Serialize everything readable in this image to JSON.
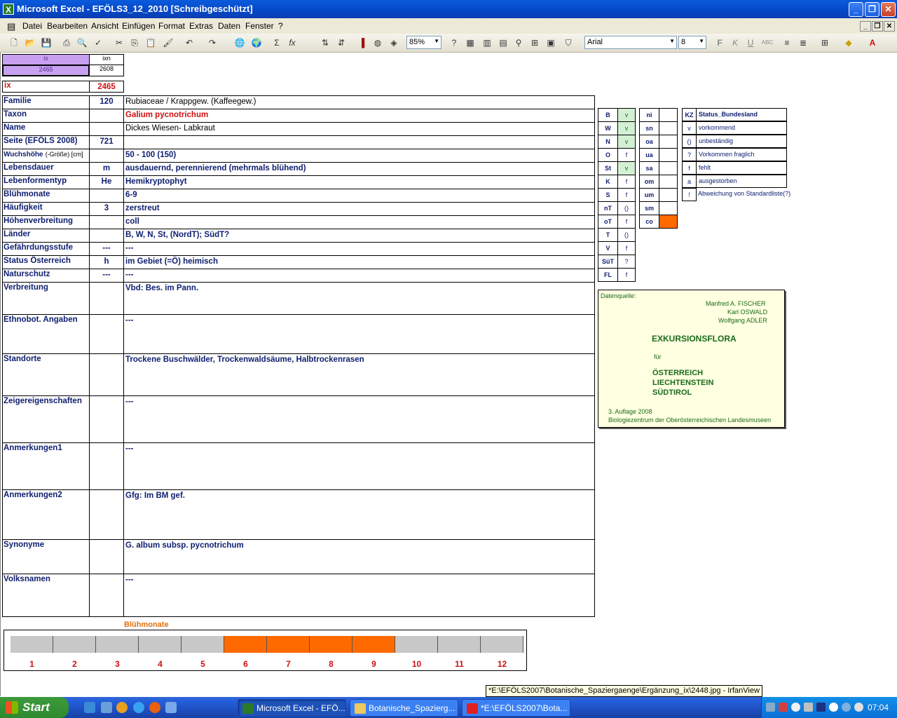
{
  "window": {
    "title": "Microsoft Excel - EFÖLS3_12_2010  [Schreibgeschützt]"
  },
  "menu": [
    "Datei",
    "Bearbeiten",
    "Ansicht",
    "Einfügen",
    "Format",
    "Extras",
    "Daten",
    "Fenster",
    "?"
  ],
  "toolbar": {
    "zoom": "85%",
    "font": "Arial",
    "font_size": "8"
  },
  "index": {
    "ix_label": "ix",
    "ixn_label": "ixn",
    "ix_value": "2465",
    "ixn_value": "2608",
    "ix_row_label": "ix",
    "ix_row_value": "2465"
  },
  "fields": [
    {
      "label": "Familie",
      "mid": "120",
      "value": "Rubiaceae  /  Krappgew. (Kaffeegew.)"
    },
    {
      "label": "Taxon",
      "mid": "",
      "value": "Galium pycnotrichum"
    },
    {
      "label": "Name",
      "mid": "",
      "value": "Dickes Wiesen- Labkraut"
    },
    {
      "label": "Seite (EFÖLS 2008)",
      "mid": "721",
      "value": ""
    },
    {
      "label": "Wuchshöhe",
      "label_suffix": "(-Größe) [cm]",
      "mid": "",
      "value": "50 - 100 (150)"
    },
    {
      "label": "Lebensdauer",
      "mid": "m",
      "value": "ausdauernd, perennierend (mehrmals blühend)"
    },
    {
      "label": "Lebenformentyp",
      "mid": "He",
      "value": "Hemikryptophyt"
    },
    {
      "label": "Blühmonate",
      "mid": "",
      "value": "6-9"
    },
    {
      "label": "Häufigkeit",
      "mid": "3",
      "value": "zerstreut"
    },
    {
      "label": "Höhenverbreitung",
      "mid": "",
      "value": "coll"
    },
    {
      "label": "Länder",
      "mid": "",
      "value": "B, W, N, St, (NordT); SüdT?"
    },
    {
      "label": "Gefährdungsstufe",
      "mid": "---",
      "value": "---"
    },
    {
      "label": "Status Österreich",
      "mid": "h",
      "value": "im Gebiet (=Ö) heimisch"
    },
    {
      "label": "Naturschutz",
      "mid": "---",
      "value": "---"
    },
    {
      "label": "Verbreitung",
      "mid": "",
      "value": "Vbd: Bes. im Pann."
    },
    {
      "label": "Ethnobot. Angaben",
      "mid": "",
      "value": "---"
    },
    {
      "label": "Standorte",
      "mid": "",
      "value": "Trockene Buschwälder, Trockenwaldsäume, Halbtrockenrasen"
    },
    {
      "label": "Zeigereigenschaften",
      "mid": "",
      "value": "---"
    },
    {
      "label": "Anmerkungen1",
      "mid": "",
      "value": "---"
    },
    {
      "label": "Anmerkungen2",
      "mid": "",
      "value": "Gfg: Im BM gef."
    },
    {
      "label": "Synonyme",
      "mid": "",
      "value": "G. album subsp. pycnotrichum"
    },
    {
      "label": "Volksnamen",
      "mid": "",
      "value": "---"
    }
  ],
  "states": [
    {
      "code": "B",
      "status": "v"
    },
    {
      "code": "W",
      "status": "v"
    },
    {
      "code": "N",
      "status": "v"
    },
    {
      "code": "O",
      "status": "f"
    },
    {
      "code": "St",
      "status": "v"
    },
    {
      "code": "K",
      "status": "f"
    },
    {
      "code": "S",
      "status": "f"
    },
    {
      "code": "nT",
      "status": "()"
    },
    {
      "code": "oT",
      "status": "f"
    },
    {
      "code": "T",
      "status": "()"
    },
    {
      "code": "V",
      "status": "f"
    },
    {
      "code": "SüT",
      "status": "?"
    },
    {
      "code": "FL",
      "status": "f"
    }
  ],
  "altitude": [
    "ni",
    "sn",
    "oa",
    "ua",
    "sa",
    "om",
    "um",
    "sm",
    "co"
  ],
  "altitude_highlight_color": "#ff6a00",
  "legend": {
    "header_kz": "KZ",
    "header_status": "Status_Bundesland",
    "items": [
      {
        "kz": "v",
        "text": "vorkommend"
      },
      {
        "kz": "()",
        "text": "unbeständig"
      },
      {
        "kz": "?",
        "text": "Vorkommen fraglich"
      },
      {
        "kz": "f",
        "text": "fehlt"
      },
      {
        "kz": "a",
        "text": "ausgestorben"
      },
      {
        "kz": "!",
        "text": "Abweichung von Standardliste(?)"
      }
    ]
  },
  "datasource": {
    "label": "Datenquelle:",
    "author1": "Manfred A. FISCHER",
    "author2": "Karl OSWALD",
    "author3": "Wolfgang ADLER",
    "title": "EXKURSIONSFLORA",
    "fuer": "für",
    "country1": "ÖSTERREICH",
    "country2": "LIECHTENSTEIN",
    "country3": "SÜDTIROL",
    "edition": "3. Auflage 2008",
    "publisher": "Biologiezentrum der Oberösterreichischen Landesmuseen"
  },
  "bloom": {
    "title": "Blühmonate",
    "months": [
      "1",
      "2",
      "3",
      "4",
      "5",
      "6",
      "7",
      "8",
      "9",
      "10",
      "11",
      "12"
    ],
    "active": [
      6,
      7,
      8,
      9
    ],
    "active_color": "#ff6a00"
  },
  "tooltip": "*E:\\EFÖLS2007\\Botanische_Spaziergaenge\\Ergänzung_ix\\2448.jpg - IrfanView",
  "taskbar": {
    "start": "Start",
    "tasks": [
      "Microsoft Excel - EFÖ...",
      "Botanische_Spazierg...",
      "*E:\\EFÖLS2007\\Bota..."
    ],
    "clock": "07:04"
  }
}
